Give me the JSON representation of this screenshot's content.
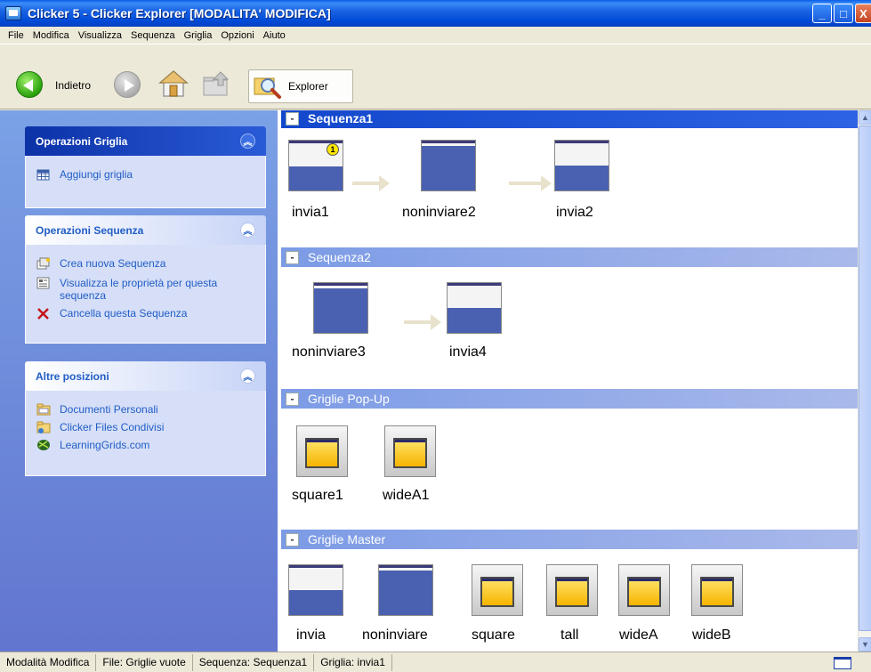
{
  "window": {
    "title": "Clicker 5 - Clicker Explorer [MODALITA' MODIFICA]",
    "minimize": "_",
    "maximize": "□",
    "close": "X"
  },
  "menu": [
    "File",
    "Modifica",
    "Visualizza",
    "Sequenza",
    "Griglia",
    "Opzioni",
    "Aiuto"
  ],
  "toolbar": {
    "back_label": "Indietro",
    "explorer_label": "Explorer"
  },
  "left_pane": {
    "grid_ops": {
      "title": "Operazioni Griglia",
      "items": [
        "Aggiungi griglia"
      ]
    },
    "seq_ops": {
      "title": "Operazioni Sequenza",
      "items": [
        "Crea nuova Sequenza",
        "Visualizza le proprietà per questa sequenza",
        "Cancella questa Sequenza"
      ]
    },
    "other": {
      "title": "Altre posizioni",
      "items": [
        "Documenti Personali",
        "Clicker Files Condivisi",
        "LearningGrids.com"
      ]
    }
  },
  "groups": [
    {
      "title": "Sequenza1",
      "items": [
        "invia1",
        "noninviare2",
        "invia2"
      ],
      "badge": "1"
    },
    {
      "title": "Sequenza2",
      "items": [
        "noninviare3",
        "invia4"
      ]
    },
    {
      "title": "Griglie Pop-Up",
      "items": [
        "square1",
        "wideA1"
      ]
    },
    {
      "title": "Griglie Master",
      "items": [
        "invia",
        "noninviare",
        "square",
        "tall",
        "wideA",
        "wideB"
      ]
    }
  ],
  "status": [
    "Modalità Modifica",
    "File: Griglie vuote",
    "Sequenza: Sequenza1",
    "Griglia: invia1"
  ]
}
